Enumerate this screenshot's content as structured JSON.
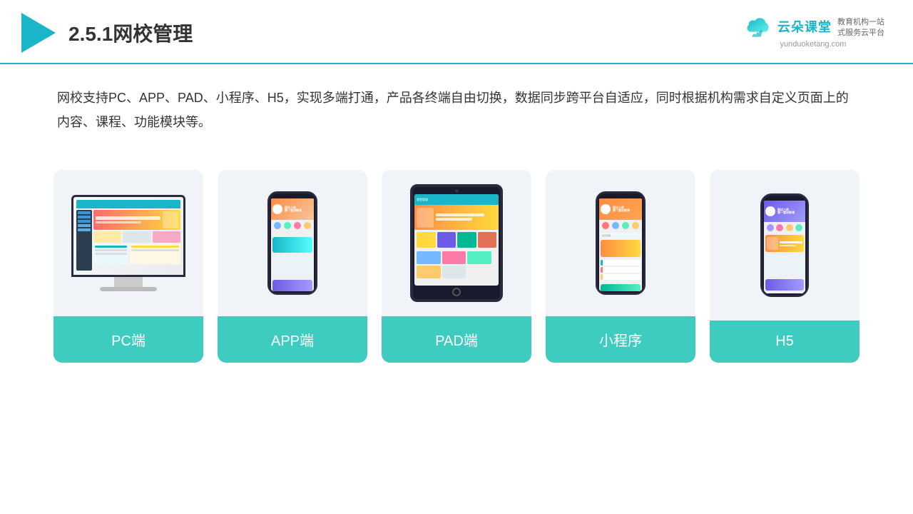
{
  "header": {
    "title": "2.5.1网校管理",
    "brand_name": "云朵课堂",
    "brand_url": "yunduoketang.com",
    "brand_tagline_line1": "教育机构一站",
    "brand_tagline_line2": "式服务云平台"
  },
  "description": {
    "text": "网校支持PC、APP、PAD、小程序、H5，实现多端打通，产品各终端自由切换，数据同步跨平台自适应，同时根据机构需求自定义页面上的内容、课程、功能模块等。"
  },
  "cards": [
    {
      "id": "pc",
      "label": "PC端"
    },
    {
      "id": "app",
      "label": "APP端"
    },
    {
      "id": "pad",
      "label": "PAD端"
    },
    {
      "id": "miniapp",
      "label": "小程序"
    },
    {
      "id": "h5",
      "label": "H5"
    }
  ],
  "colors": {
    "accent": "#1ab5c8",
    "card_label_bg": "#3eccc0",
    "card_bg": "#f0f4f8"
  }
}
